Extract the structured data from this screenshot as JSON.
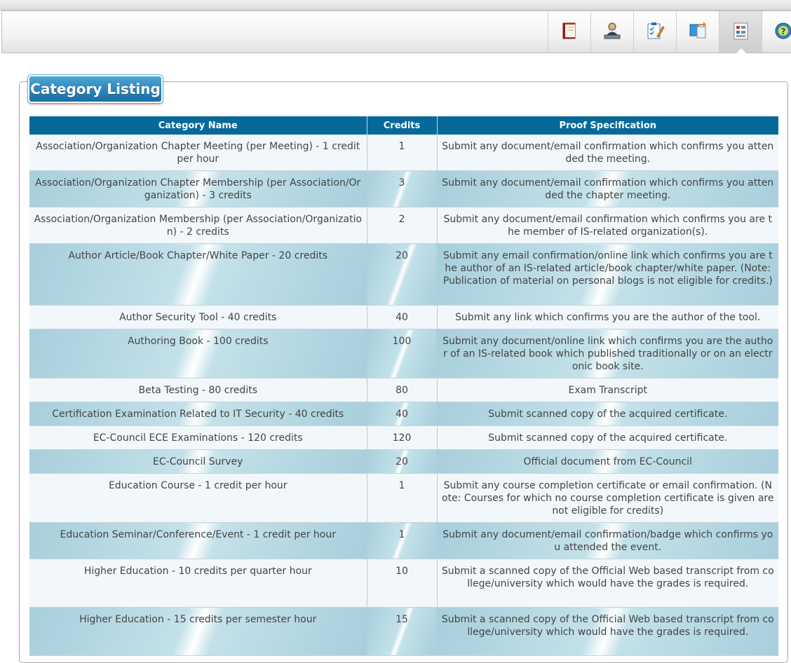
{
  "toolbar": {
    "icons": [
      "notebook-icon",
      "user-profile-icon",
      "checklist-pencil-icon",
      "document-transfer-icon",
      "category-listing-icon",
      "help-icon"
    ],
    "active_index": 4
  },
  "section": {
    "title": "Category Listing"
  },
  "table": {
    "headers": [
      "Category Name",
      "Credits",
      "Proof Specification"
    ],
    "rows": [
      {
        "name": "Association/Organization Chapter Meeting (per Meeting) - 1 credit per hour",
        "credits": "1",
        "proof": "Submit any document/email confirmation which confirms you attended the meeting."
      },
      {
        "name": "Association/Organization Chapter Membership (per Association/Organization) - 3 credits",
        "credits": "3",
        "proof": "Submit any document/email confirmation which confirms you attended the chapter meeting."
      },
      {
        "name": "Association/Organization Membership (per Association/Organization) - 2 credits",
        "credits": "2",
        "proof": "Submit any document/email confirmation which confirms you are the member of IS-related organization(s)."
      },
      {
        "name": "Author Article/Book Chapter/White Paper - 20 credits",
        "credits": "20",
        "proof": "Submit any email confirmation/online link which confirms you are the author of an IS-related article/book chapter/white paper. (Note: Publication of material on personal blogs is not eligible for credits.)"
      },
      {
        "name": "Author Security Tool - 40 credits",
        "credits": "40",
        "proof": "Submit any link which confirms you are the author of the tool."
      },
      {
        "name": "Authoring Book - 100 credits",
        "credits": "100",
        "proof": "Submit any document/online link which confirms you are the author of an IS-related book which published traditionally or on an electronic book site."
      },
      {
        "name": "Beta Testing - 80 credits",
        "credits": "80",
        "proof": "Exam Transcript"
      },
      {
        "name": "Certification Examination Related to IT Security - 40 credits",
        "credits": "40",
        "proof": "Submit scanned copy of the acquired certificate."
      },
      {
        "name": "EC-Council ECE Examinations - 120 credits",
        "credits": "120",
        "proof": "Submit scanned copy of the acquired certificate."
      },
      {
        "name": "EC-Council Survey",
        "credits": "20",
        "proof": "Official document from EC-Council"
      },
      {
        "name": "Education Course - 1 credit per hour",
        "credits": "1",
        "proof": "Submit any course completion certificate or email confirmation. (Note: Courses for which no course completion certificate is given are not eligible for credits)"
      },
      {
        "name": "Education Seminar/Conference/Event - 1 credit per hour",
        "credits": "1",
        "proof": "Submit any document/email confirmation/badge which confirms you attended the event."
      },
      {
        "name": "Higher Education - 10 credits per quarter hour",
        "credits": "10",
        "proof": "Submit a scanned copy of the Official Web based transcript from college/university which would have the grades is required."
      },
      {
        "name": "Higher Education - 15 credits per semester hour",
        "credits": "15",
        "proof": "Submit a scanned copy of the Official Web based transcript from college/university which would have the grades is required."
      }
    ]
  }
}
